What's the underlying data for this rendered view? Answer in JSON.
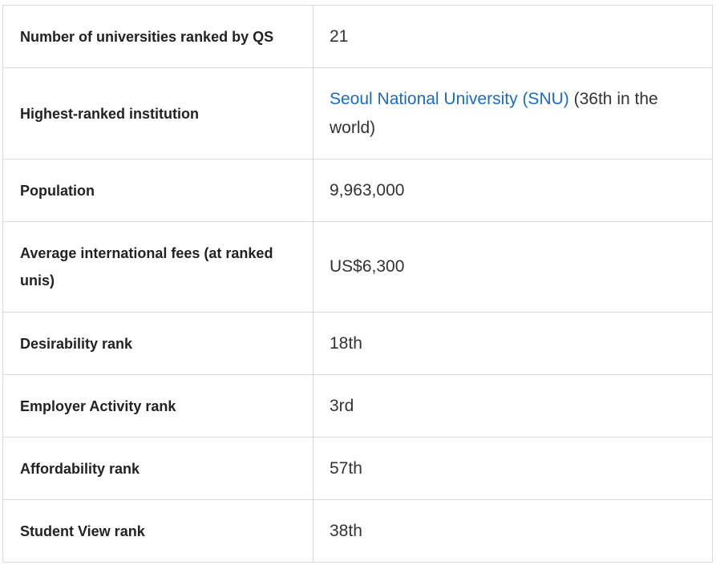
{
  "rows": [
    {
      "label": "Number of universities ranked by QS",
      "value": "21"
    },
    {
      "label": "Highest-ranked institution",
      "link_text": "Seoul National University (SNU)",
      "value_suffix": " (36th in the world)"
    },
    {
      "label": "Population",
      "value": "9,963,000"
    },
    {
      "label": "Average international fees (at ranked unis)",
      "value": "US$6,300"
    },
    {
      "label": "Desirability rank",
      "value": "18th"
    },
    {
      "label": "Employer Activity rank",
      "value": "3rd"
    },
    {
      "label": "Affordability rank",
      "value": "57th"
    },
    {
      "label": "Student View rank",
      "value": "38th"
    }
  ],
  "colors": {
    "link": "#1a6bc4",
    "border": "#d9d9d9",
    "text": "#222222"
  }
}
